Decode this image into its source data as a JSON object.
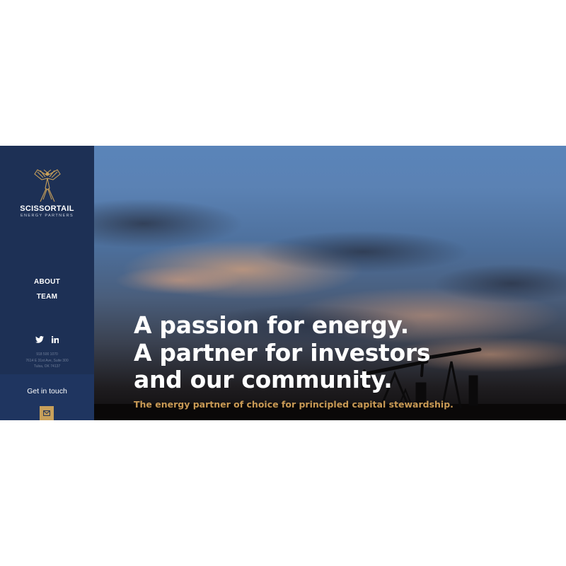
{
  "brand": {
    "name": "SCISSORTAIL",
    "sub": "ENERGY PARTNERS",
    "logo_icon": "scissortail-bird-icon",
    "accent_color": "#c8a05a",
    "sidebar_color": "#1d3055"
  },
  "nav": {
    "items": [
      {
        "label": "ABOUT"
      },
      {
        "label": "TEAM"
      }
    ]
  },
  "social": {
    "icons": [
      "twitter-icon",
      "linkedin-icon"
    ]
  },
  "contact": {
    "phone": "918 500 1070",
    "address_line1": "7614 E 31st Ave, Suite 300",
    "address_line2": "Tulsa, OK 74137",
    "cta_label": "Get in touch",
    "cta_icon": "mail-icon"
  },
  "hero": {
    "headline": [
      "A passion for energy.",
      "A partner for investors",
      "and our community."
    ],
    "tagline": "The energy partner of choice for principled capital stewardship.",
    "tagline_color": "#c99a55"
  }
}
